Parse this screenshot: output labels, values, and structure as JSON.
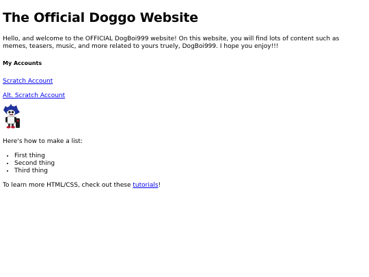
{
  "heading": "The Official Doggo Website",
  "intro": "Hello, and welcome to the OFFICIAL DogBoi999 website! On this website, you will find lots of content such as memes, teasers, music, and more related to yours truely, DogBoi999. I hope you enjoy!!!",
  "accounts_heading": "My Accounts",
  "accounts": [
    {
      "label": "Scratch Account"
    },
    {
      "label": "Alt. Scratch Account"
    }
  ],
  "avatar_icon": "dog-character-icon",
  "list_intro": "Here's how to make a list:",
  "list_items": [
    "First thing",
    "Second thing",
    "Third thing"
  ],
  "learn_more": {
    "before": "To learn more HTML/CSS, check out these ",
    "link": "tutorials",
    "after": "!"
  },
  "colors": {
    "link": "#0000ee",
    "text": "#000000"
  }
}
